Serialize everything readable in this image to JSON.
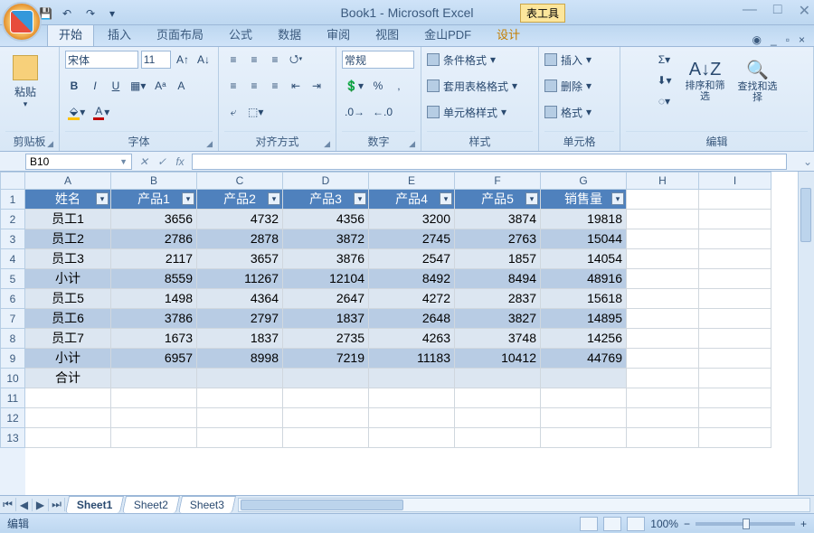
{
  "title": "Book1 - Microsoft Excel",
  "table_tools": "表工具",
  "qat": {
    "save": "💾",
    "undo": "↶",
    "redo": "↷"
  },
  "tabs": {
    "home": "开始",
    "insert": "插入",
    "layout": "页面布局",
    "formula": "公式",
    "data": "数据",
    "review": "审阅",
    "view": "视图",
    "pdf": "金山PDF",
    "design": "设计"
  },
  "ribbon": {
    "clipboard": {
      "paste": "粘贴",
      "label": "剪贴板"
    },
    "font": {
      "name": "宋体",
      "size": "11",
      "label": "字体",
      "bold": "B",
      "italic": "I",
      "underline": "U"
    },
    "alignment": {
      "label": "对齐方式"
    },
    "number": {
      "format": "常规",
      "label": "数字"
    },
    "styles": {
      "cond": "条件格式",
      "table": "套用表格格式",
      "cell": "单元格样式",
      "label": "样式"
    },
    "cells": {
      "insert": "插入",
      "delete": "删除",
      "format": "格式",
      "label": "单元格"
    },
    "editing": {
      "sort": "排序和筛选",
      "find": "查找和选择",
      "label": "编辑"
    }
  },
  "namebox": "B10",
  "columns": [
    "A",
    "B",
    "C",
    "D",
    "E",
    "F",
    "G",
    "H",
    "I"
  ],
  "rows": [
    "1",
    "2",
    "3",
    "4",
    "5",
    "6",
    "7",
    "8",
    "9",
    "10",
    "11",
    "12",
    "13"
  ],
  "headers": [
    "姓名",
    "产品1",
    "产品2",
    "产品3",
    "产品4",
    "产品5",
    "销售量"
  ],
  "data": [
    [
      "员工1",
      "3656",
      "4732",
      "4356",
      "3200",
      "3874",
      "19818"
    ],
    [
      "员工2",
      "2786",
      "2878",
      "3872",
      "2745",
      "2763",
      "15044"
    ],
    [
      "员工3",
      "2117",
      "3657",
      "3876",
      "2547",
      "1857",
      "14054"
    ],
    [
      "小计",
      "8559",
      "11267",
      "12104",
      "8492",
      "8494",
      "48916"
    ],
    [
      "员工5",
      "1498",
      "4364",
      "2647",
      "4272",
      "2837",
      "15618"
    ],
    [
      "员工6",
      "3786",
      "2797",
      "1837",
      "2648",
      "3827",
      "14895"
    ],
    [
      "员工7",
      "1673",
      "1837",
      "2735",
      "4263",
      "3748",
      "14256"
    ],
    [
      "小计",
      "6957",
      "8998",
      "7219",
      "11183",
      "10412",
      "44769"
    ],
    [
      "合计",
      "",
      "",
      "",
      "",
      "",
      ""
    ]
  ],
  "sheets": [
    "Sheet1",
    "Sheet2",
    "Sheet3"
  ],
  "status": {
    "mode": "编辑",
    "zoom": "100%"
  }
}
